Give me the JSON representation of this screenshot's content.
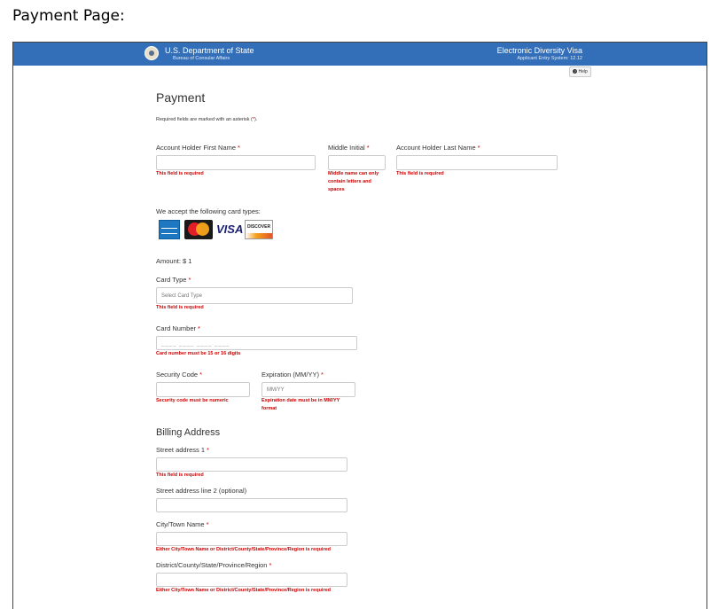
{
  "caption": "Payment Page:",
  "header": {
    "department": "U.S. Department of State",
    "bureau": "Bureau of Consular Affairs",
    "system_name": "Electronic Diversity Visa",
    "system_version": "Applicant Entry System: 12.12",
    "brand_color": "#336fb8"
  },
  "help": {
    "label": "Help",
    "icon": "?"
  },
  "page": {
    "title": "Payment",
    "required_note_prefix": "Required fields are marked with an asterisk (",
    "required_note_asterisk": "*",
    "required_note_suffix": ")."
  },
  "required_marker": "*",
  "name": {
    "first_label": "Account Holder First Name",
    "first_error": "This field is required",
    "middle_label": "Middle Initial",
    "middle_error_line1": "Middle name can only",
    "middle_error_line2": "contain letters and",
    "middle_error_line3": "spaces",
    "last_label": "Account Holder Last Name",
    "last_error": "This field is required"
  },
  "cards": {
    "intro": "We accept the following card types:",
    "icons": [
      "amex-card-icon",
      "mastercard-icon",
      "visa-card-icon",
      "discover-card-icon"
    ],
    "visa_text": "VISA",
    "discover_text": "DISCOVER"
  },
  "amount": "Amount: $ 1",
  "card_type": {
    "label": "Card Type",
    "placeholder": "Select Card Type",
    "error": "This field is required"
  },
  "card_number": {
    "label": "Card Number",
    "placeholder": "____ ____ ____ ____",
    "error": "Card number must be 15 or 16 digits"
  },
  "security_code": {
    "label": "Security Code",
    "error": "Security code must be numeric"
  },
  "expiration": {
    "label": "Expiration (MM/YY)",
    "placeholder": "MM/YY",
    "error_line1": "Expiration date must be in MM/YY",
    "error_line2": "format"
  },
  "billing": {
    "title": "Billing Address",
    "street1_label": "Street address 1",
    "street1_error": "This field is required",
    "street2_label": "Street address line 2 (optional)",
    "city_label": "City/Town Name",
    "city_error": "Either City/Town Name or District/County/State/Province/Region is required",
    "district_label": "District/County/State/Province/Region",
    "district_error": "Either City/Town Name or District/County/State/Province/Region is required"
  },
  "colors": {
    "error": "#cc0000",
    "asterisk": "#cc0000",
    "field_border": "#cccccc"
  }
}
